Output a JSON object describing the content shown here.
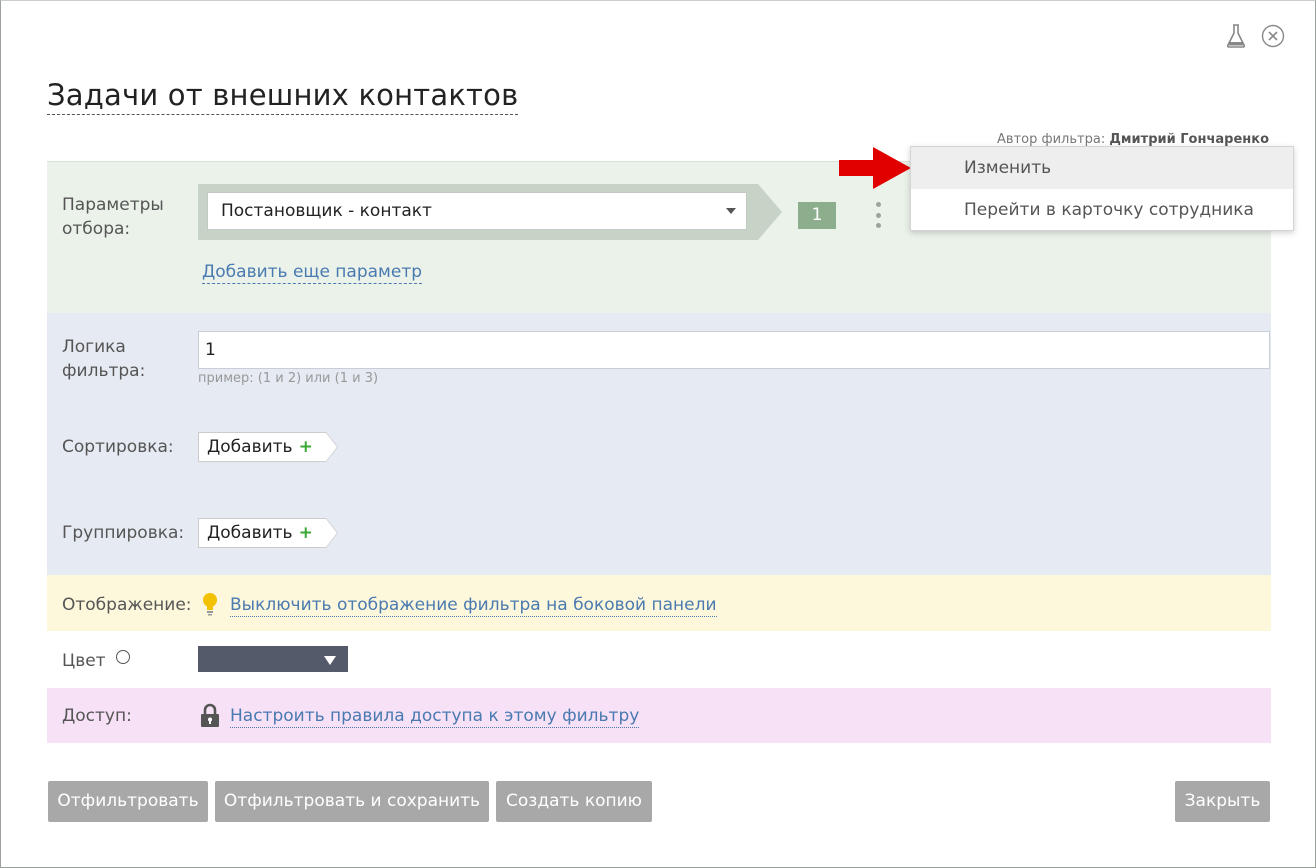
{
  "title": "Задачи от внешних контактов",
  "author": {
    "label": "Автор фильтра:",
    "name": "Дмитрий Гончаренко"
  },
  "params": {
    "label": "Параметры отбора:",
    "selected": "Постановщик - контакт",
    "number": "1",
    "add_link": "Добавить еще параметр"
  },
  "logic": {
    "label": "Логика фильтра:",
    "value": "1",
    "hint": "пример: (1 и 2) или (1 и 3)"
  },
  "sort": {
    "label": "Сортировка:",
    "add": "Добавить",
    "plus": "+"
  },
  "group": {
    "label": "Группировка:",
    "add": "Добавить",
    "plus": "+"
  },
  "display": {
    "label": "Отображение:",
    "link": "Выключить отображение фильтра на боковой панели"
  },
  "color": {
    "label": "Цвет",
    "value": "#555a6a"
  },
  "access": {
    "label": "Доступ:",
    "link": "Настроить правила доступа к этому фильтру"
  },
  "buttons": {
    "filter": "Отфильтровать",
    "filter_save": "Отфильтровать и сохранить",
    "copy": "Создать копию",
    "close": "Закрыть"
  },
  "context_menu": {
    "items": [
      "Изменить",
      "Перейти в карточку сотрудника"
    ]
  }
}
